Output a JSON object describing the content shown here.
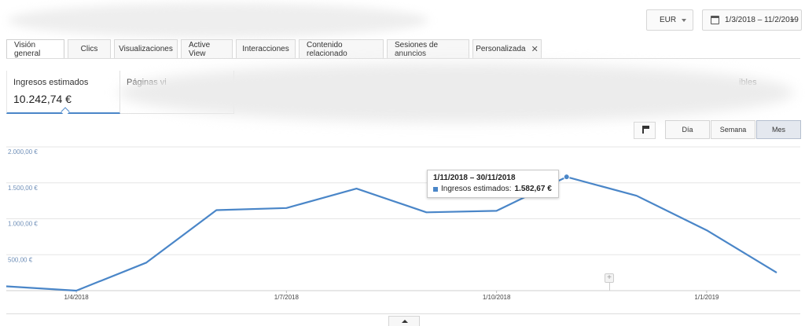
{
  "header": {
    "currency": "EUR",
    "date_range": "1/3/2018 – 11/2/2019"
  },
  "tabs": [
    {
      "label": "Visión general"
    },
    {
      "label": "Clics"
    },
    {
      "label": "Visualizaciones"
    },
    {
      "label": "Active View"
    },
    {
      "label": "Interacciones"
    },
    {
      "label": "Contenido relacionado"
    },
    {
      "label": "Sesiones de anuncios"
    },
    {
      "label": "Personalizada",
      "close": "✕"
    }
  ],
  "metrics": {
    "primary_label": "Ingresos estimados",
    "primary_value": "10.242,74 €",
    "second_label": "Páginas vi",
    "right_label": "ibles"
  },
  "granularity": [
    "Día",
    "Semana",
    "Mes"
  ],
  "chart_data": {
    "type": "line",
    "series": [
      {
        "name": "Ingresos estimados",
        "x": [
          "2018-03-01",
          "2018-04-01",
          "2018-05-01",
          "2018-06-01",
          "2018-07-01",
          "2018-08-01",
          "2018-09-01",
          "2018-10-01",
          "2018-11-01",
          "2018-12-01",
          "2019-01-01",
          "2019-02-01"
        ],
        "values": [
          60,
          0,
          390,
          1120,
          1150,
          1420,
          1090,
          1110,
          1582.67,
          1320,
          840,
          250
        ],
        "color": "#4a86c8"
      }
    ],
    "yticks": [
      "2.000,00 €",
      "1.500,00 €",
      "1.000,00 €",
      "500,00 €"
    ],
    "ytick_values": [
      2000,
      1500,
      1000,
      500
    ],
    "ylim": [
      0,
      2000
    ],
    "xticks": [
      "1/4/2018",
      "1/7/2018",
      "1/10/2018",
      "1/1/2019"
    ],
    "xtick_index": [
      1,
      4,
      7,
      10
    ],
    "grid": true
  },
  "tooltip": {
    "date": "1/11/2018 – 30/11/2018",
    "label": "Ingresos estimados:",
    "value": "1.582,67 €"
  },
  "annotation_marker": "+"
}
